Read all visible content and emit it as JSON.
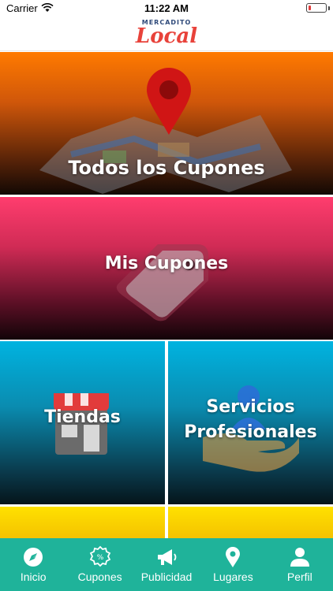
{
  "status_bar": {
    "carrier": "Carrier",
    "time": "11:22 AM",
    "battery_level": 0.15
  },
  "header": {
    "logo_small": "MERCADITO",
    "logo_main": "Local"
  },
  "tiles": {
    "todos": "Todos los Cupones",
    "mis": "Mis Cupones",
    "tiendas": "Tiendas",
    "servicios_line1": "Servicios",
    "servicios_line2": "Profesionales"
  },
  "tab_bar": [
    {
      "label": "Inicio",
      "icon": "compass-icon"
    },
    {
      "label": "Cupones",
      "icon": "discount-badge-icon"
    },
    {
      "label": "Publicidad",
      "icon": "megaphone-icon"
    },
    {
      "label": "Lugares",
      "icon": "location-pin-icon"
    },
    {
      "label": "Perfil",
      "icon": "person-icon"
    }
  ],
  "colors": {
    "tab_bar": "#1fb39a",
    "logo_red": "#e8423a",
    "orange_tile": "#ff7a00",
    "pink_tile": "#ff3d6e",
    "blue_tile": "#00b3e0",
    "yellow_tile": "#ffe100"
  }
}
